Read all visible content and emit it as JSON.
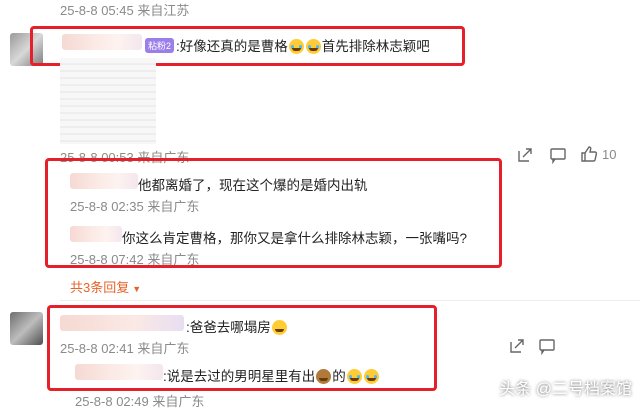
{
  "comments": [
    {
      "time_meta": "25-8-8 05:45 来自江苏"
    },
    {
      "badge": "粘粉2",
      "text_a": ":好像还真的是曹格",
      "text_b": "首先排除林志颖吧",
      "time_meta": "25-8-8 00:53 来自广东",
      "like_count": "10",
      "replies": [
        {
          "text": "他都离婚了，现在这个爆的是婚内出轨",
          "time_meta": "25-8-8 02:35 来自广东"
        },
        {
          "text": "你这么肯定曹格，那你又是拿什么排除林志颖，一张嘴吗?",
          "time_meta": "25-8-8 07:42 来自广东"
        }
      ],
      "reply_link": "共3条回复"
    },
    {
      "text": ":爸爸去哪塌房",
      "time_meta": "25-8-8 02:41 来自广东",
      "sub_text_a": ":说是去过的男明星里有出",
      "sub_text_b": "的",
      "sub_time_meta": "25-8-8 02:49 来自广东"
    }
  ],
  "colors": {
    "highlight_border": "#e5202a",
    "reply_link": "#e3642b",
    "meta": "#8a8a8a"
  },
  "icons": [
    "share-icon",
    "comment-icon",
    "like-icon"
  ],
  "watermark": "头条 @二号档案馆"
}
